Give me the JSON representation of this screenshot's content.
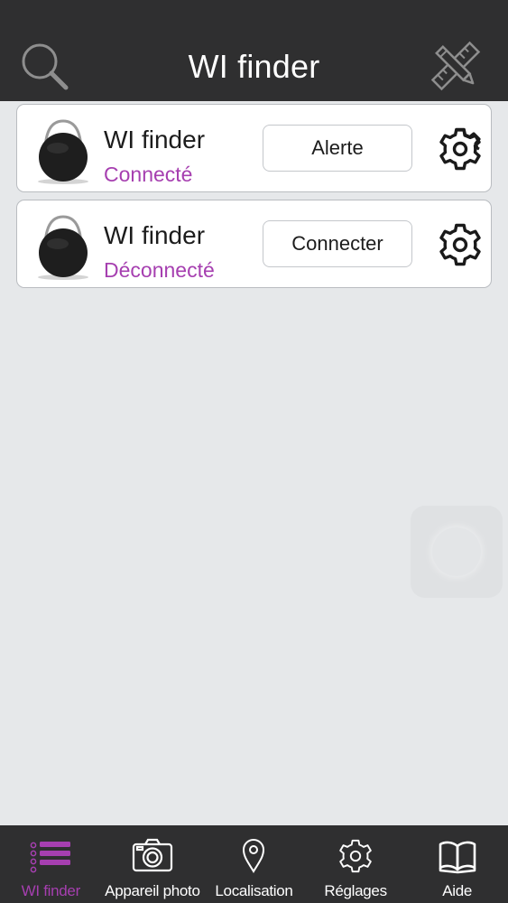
{
  "header": {
    "title": "WI finder",
    "left_icon": "search-icon",
    "right_icon": "ruler-pencil-icon"
  },
  "devices": [
    {
      "name": "WI finder",
      "status": "Connecté",
      "action_label": "Alerte",
      "icon": "tag-device-icon",
      "settings_icon": "gear-icon"
    },
    {
      "name": "WI finder",
      "status": "Déconnecté",
      "action_label": "Connecter",
      "icon": "tag-device-icon",
      "settings_icon": "gear-icon"
    }
  ],
  "tabbar": {
    "active": "WI finder",
    "tabs": [
      {
        "label": "WI finder",
        "icon": "list-icon"
      },
      {
        "label": "Appareil photo",
        "icon": "camera-icon"
      },
      {
        "label": "Localisation",
        "icon": "map-pin-icon"
      },
      {
        "label": "Réglages",
        "icon": "gear-icon"
      },
      {
        "label": "Aide",
        "icon": "book-icon"
      }
    ]
  },
  "colors": {
    "header_bg": "#2f2f30",
    "background": "#e6e8ea",
    "accent": "#a63fb0",
    "card_bg": "#ffffff"
  }
}
